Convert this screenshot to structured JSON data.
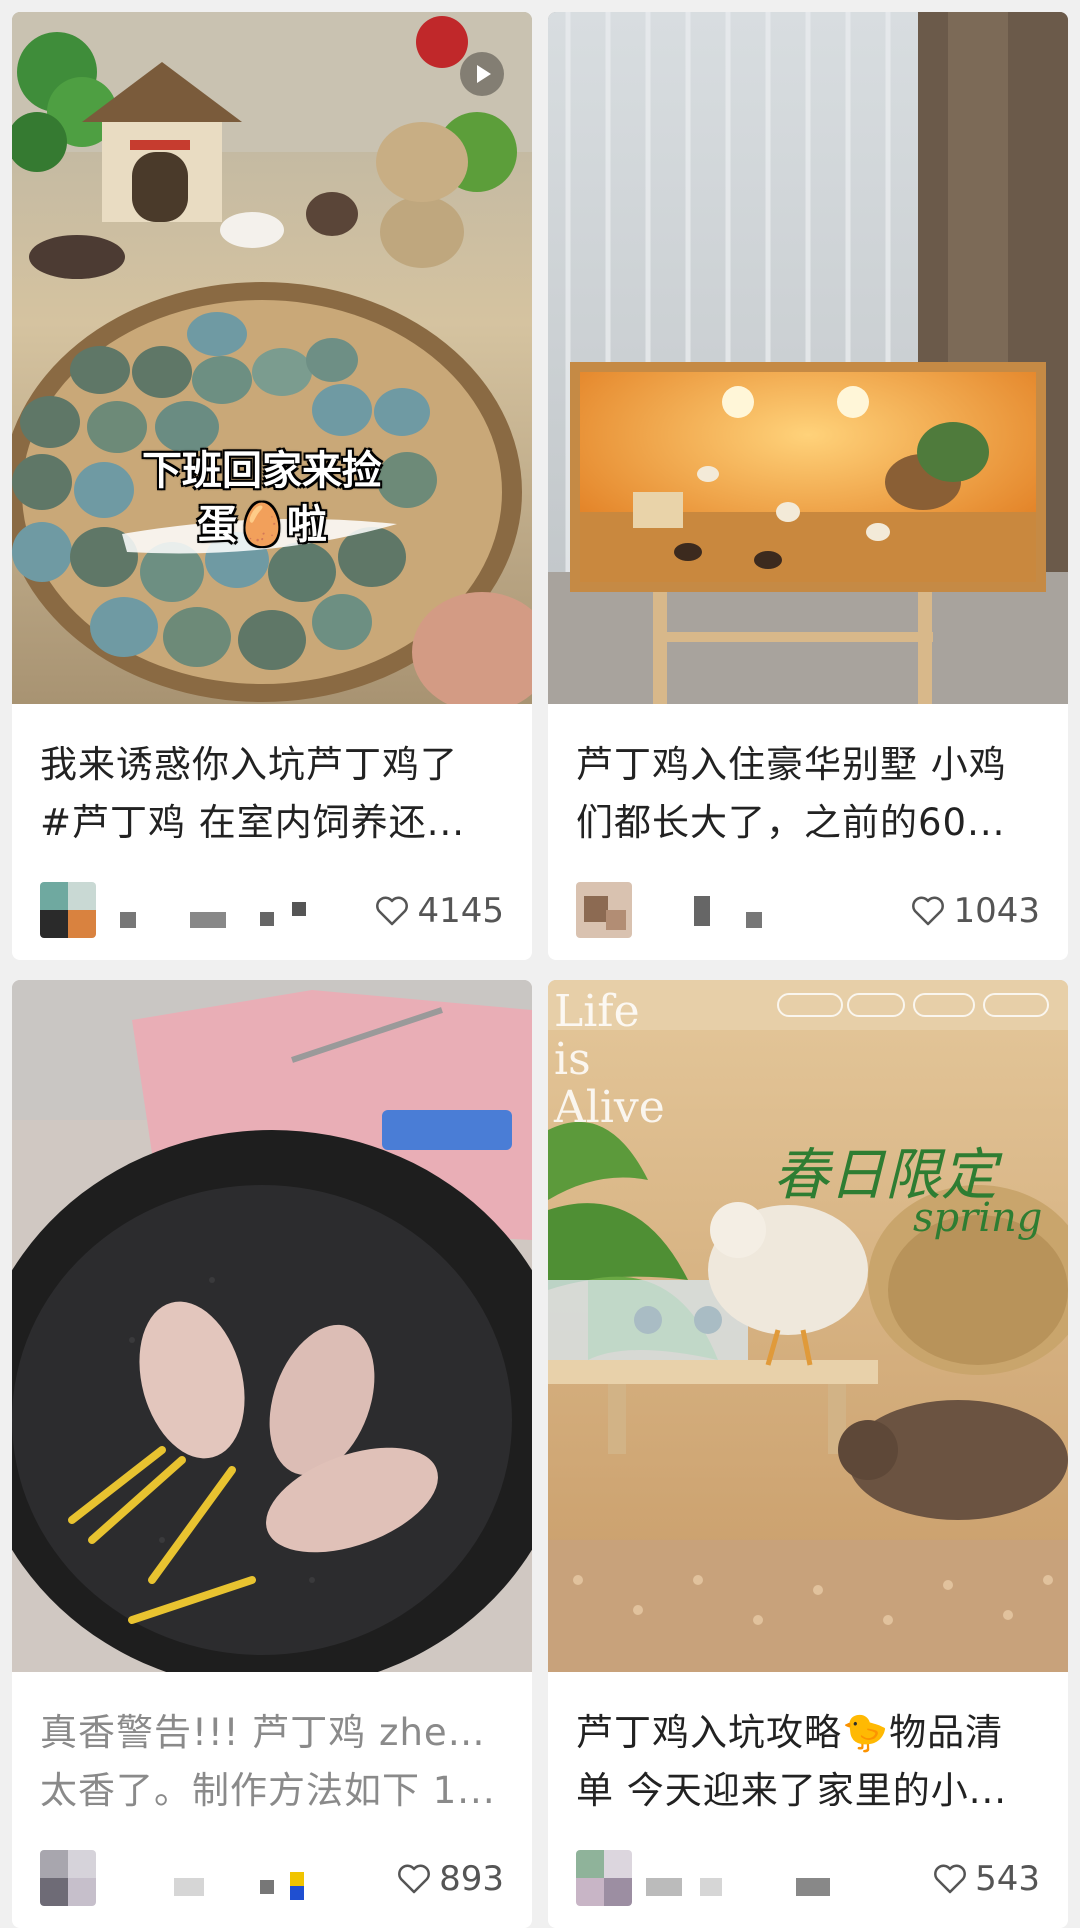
{
  "feed": {
    "cards": [
      {
        "title_line1": "我来诱惑你入坑芦丁鸡了",
        "title_line2": "#芦丁鸡  在室内饲养还...",
        "likes": "4145",
        "image_caption_line1": "下班回家来捡",
        "image_caption_line2": "蛋🥚啦",
        "is_video": true
      },
      {
        "title_line1": "芦丁鸡入住豪华别墅 小鸡",
        "title_line2": "们都长大了，之前的60...",
        "likes": "1043"
      },
      {
        "title_line1": "真香警告!!! 芦丁鸡 zhen的",
        "title_line2": "太香了。制作方法如下 1...",
        "likes": "893"
      },
      {
        "title_line1": "芦丁鸡入坑攻略🐤物品清",
        "title_line2": "单 今天迎来了家里的小...",
        "likes": "543",
        "poster_text": [
          "Life",
          "is",
          "Alive"
        ],
        "poster_handwriting": "春日限定",
        "poster_handwriting_en": "spring"
      }
    ]
  },
  "icons": {
    "like": "heart-outline-icon",
    "play": "play-icon"
  },
  "colors": {
    "background": "#f0f0f0",
    "card": "#ffffff",
    "title": "#222222",
    "title_muted": "#8a8a8a",
    "likes": "#555555"
  }
}
